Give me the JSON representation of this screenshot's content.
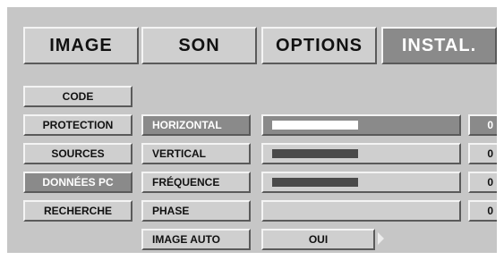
{
  "tabs": [
    {
      "label": "IMAGE",
      "active": false
    },
    {
      "label": "SON",
      "active": false
    },
    {
      "label": "OPTIONS",
      "active": false
    },
    {
      "label": "INSTAL.",
      "active": true
    }
  ],
  "sidebar": {
    "items": [
      {
        "label": "CODE",
        "active": false
      },
      {
        "label": "PROTECTION",
        "active": false
      },
      {
        "label": "SOURCES",
        "active": false
      },
      {
        "label": "DONNÉES PC",
        "active": true
      },
      {
        "label": "RECHERCHE",
        "active": false
      }
    ]
  },
  "settings": [
    {
      "label": "HORIZONTAL",
      "level_pct": 48,
      "value": "0",
      "active": true
    },
    {
      "label": "VERTICAL",
      "level_pct": 48,
      "value": "0",
      "active": false
    },
    {
      "label": "FRÉQUENCE",
      "level_pct": 48,
      "value": "0",
      "active": false
    },
    {
      "label": "PHASE",
      "level_pct": 0,
      "value": "0",
      "active": false
    }
  ],
  "auto": {
    "label": "IMAGE AUTO",
    "value": "OUI"
  },
  "colors": {
    "panel": "#c6c6c6",
    "button": "#cfcfcf",
    "active": "#8a8a8a",
    "bar_fill": "#4a4a4a"
  }
}
